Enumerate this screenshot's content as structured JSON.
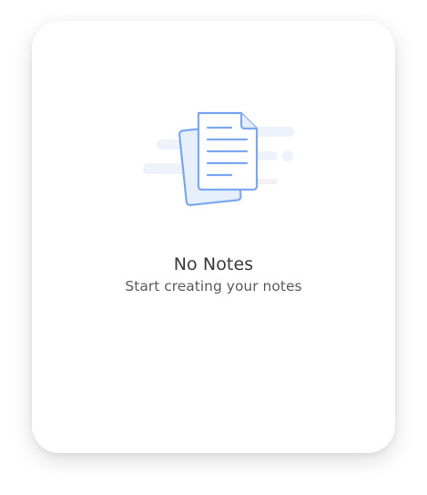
{
  "empty_state": {
    "icon": "notes-documents-icon",
    "title": "No Notes",
    "subtitle": "Start creating your notes"
  },
  "colors": {
    "card_background": "#ffffff",
    "icon_stroke": "#7aa7f0",
    "icon_fill": "#eaf1fd",
    "decor_lines": "#eef3fb",
    "title_text": "#3a3a3a",
    "subtitle_text": "#5c5c5c"
  }
}
